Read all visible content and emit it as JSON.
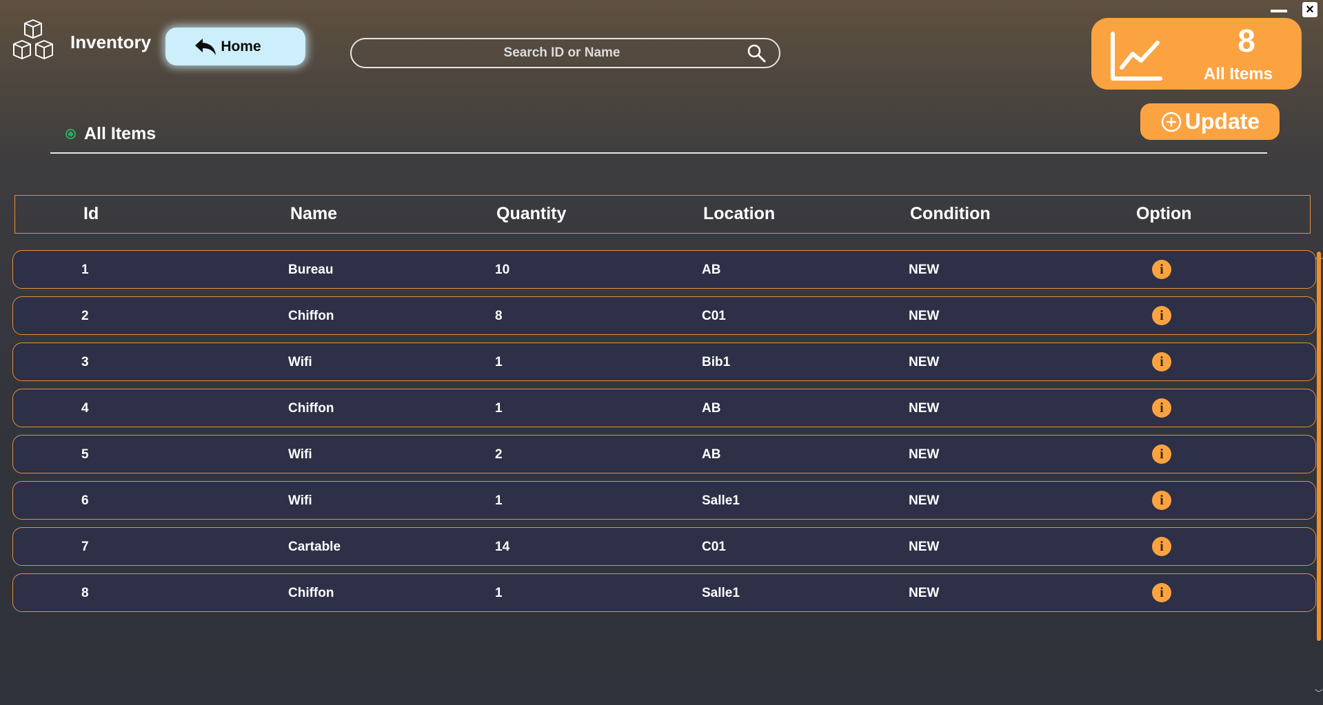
{
  "app": {
    "title": "Inventory"
  },
  "nav": {
    "home_label": "Home"
  },
  "search": {
    "placeholder": "Search ID or Name"
  },
  "stats": {
    "count": "8",
    "label": "All Items"
  },
  "actions": {
    "update_label": "Update"
  },
  "section": {
    "tab_label": "All Items"
  },
  "table": {
    "columns": [
      "Id",
      "Name",
      "Quantity",
      "Location",
      "Condition",
      "Option"
    ],
    "rows": [
      {
        "id": "1",
        "name": "Bureau",
        "quantity": "10",
        "location": "AB",
        "condition": "NEW"
      },
      {
        "id": "2",
        "name": "Chiffon",
        "quantity": "8",
        "location": "C01",
        "condition": "NEW"
      },
      {
        "id": "3",
        "name": "Wifi",
        "quantity": "1",
        "location": "Bib1",
        "condition": "NEW"
      },
      {
        "id": "4",
        "name": "Chiffon",
        "quantity": "1",
        "location": "AB",
        "condition": "NEW"
      },
      {
        "id": "5",
        "name": "Wifi",
        "quantity": "2",
        "location": "AB",
        "condition": "NEW"
      },
      {
        "id": "6",
        "name": "Wifi",
        "quantity": "1",
        "location": "Salle1",
        "condition": "NEW"
      },
      {
        "id": "7",
        "name": "Cartable",
        "quantity": "14",
        "location": "C01",
        "condition": "NEW"
      },
      {
        "id": "8",
        "name": "Chiffon",
        "quantity": "1",
        "location": "Salle1",
        "condition": "NEW"
      }
    ]
  },
  "icons": {
    "logo": "boxes-icon",
    "home": "reply-arrow-icon",
    "search": "search-icon",
    "stats": "trend-chart-icon",
    "update": "plus-circle-icon",
    "row_option": "info-icon",
    "close": "close-icon",
    "minimize": "minimize-icon"
  },
  "colors": {
    "accent": "#fba341",
    "row_border": "#e3923a",
    "row_bg": "#2d3047",
    "home_bg": "#cdeefb",
    "radio": "#27ae60"
  }
}
